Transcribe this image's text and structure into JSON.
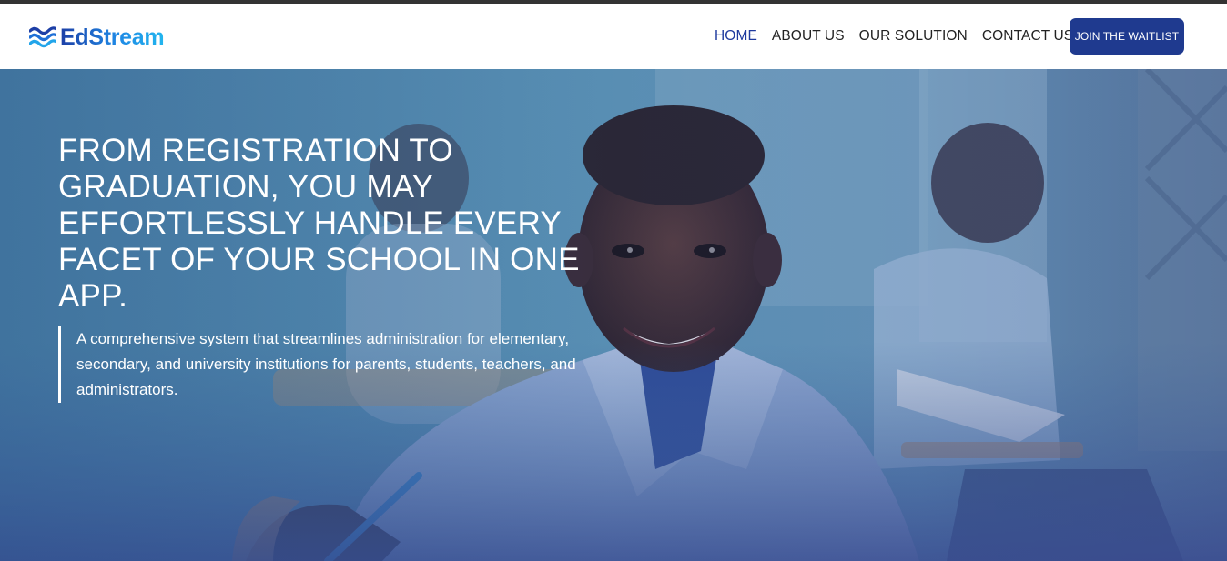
{
  "brand": {
    "name": "EdStream",
    "colors": {
      "primary": "#1f3a8f",
      "accent": "#22b5ee",
      "nav_active": "#1e3a9e"
    }
  },
  "nav": {
    "items": [
      {
        "label": "HOME",
        "active": true
      },
      {
        "label": "ABOUT US",
        "active": false
      },
      {
        "label": "OUR SOLUTION",
        "active": false
      },
      {
        "label": "CONTACT US",
        "active": false
      }
    ],
    "cta_label": "JOIN THE WAITLIST"
  },
  "hero": {
    "title": "FROM REGISTRATION TO GRADUATION, YOU MAY EFFORTLESSLY HANDLE EVERY FACET OF YOUR SCHOOL IN ONE APP.",
    "description": "A comprehensive system that streamlines administration for elementary, secondary, and university institutions for parents, students, teachers, and administrators.",
    "image": "classroom-photo-smiling-student"
  }
}
